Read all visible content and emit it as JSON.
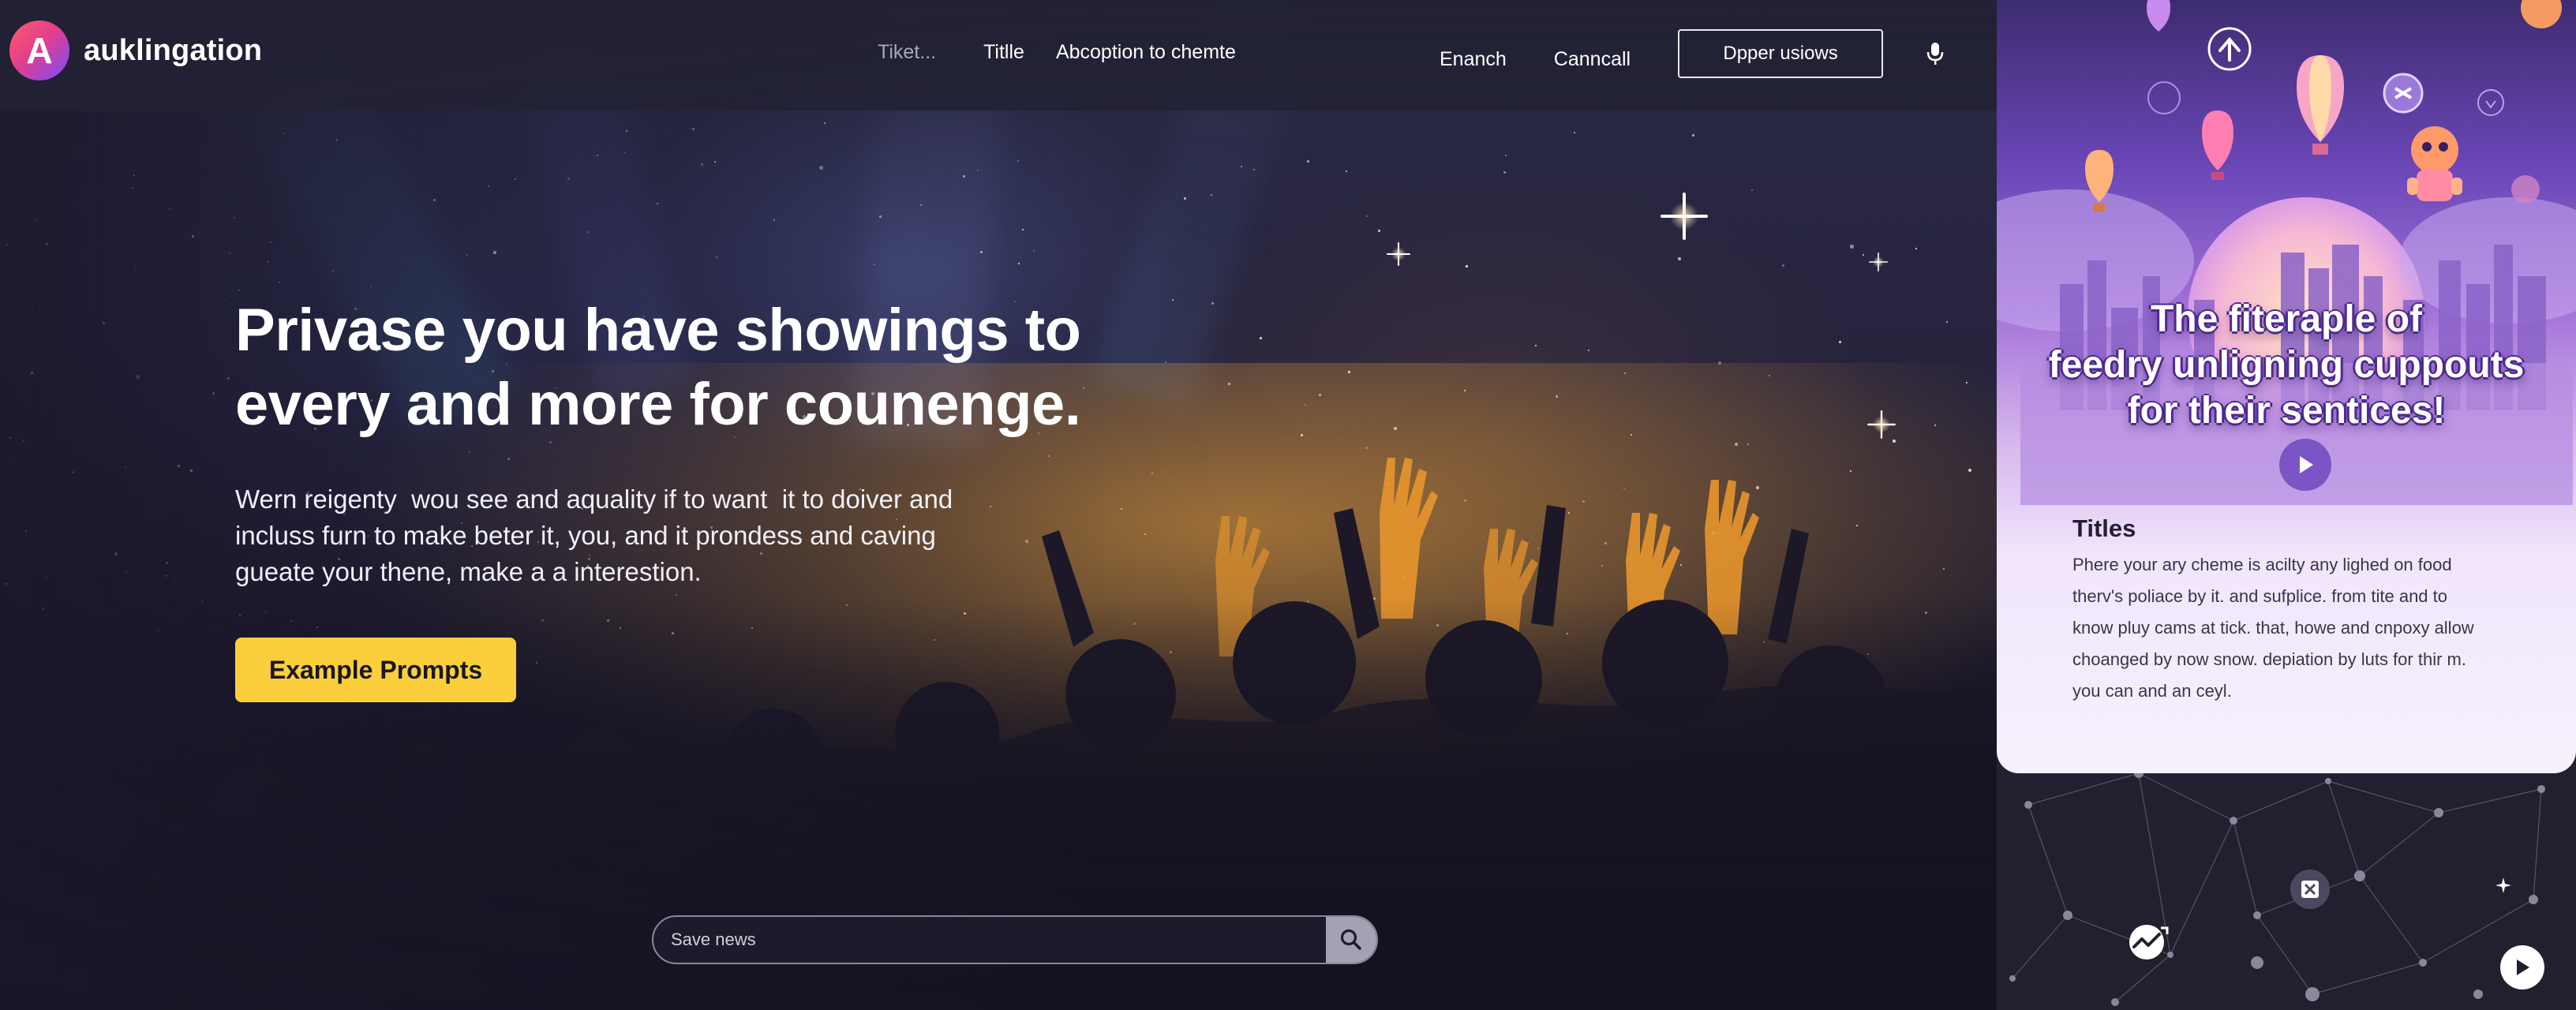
{
  "brand": {
    "logo_letter": "A",
    "name": "auklingation"
  },
  "nav": {
    "center": [
      {
        "label": "Tiket..."
      },
      {
        "label": "Titlle"
      },
      {
        "label": "Abcoption to chemte"
      }
    ],
    "right": [
      {
        "label": "Enanch"
      },
      {
        "label": "Canncall"
      }
    ],
    "outline_button": "Dpper usiows",
    "mic_icon": "microphone-icon"
  },
  "hero": {
    "headline_line1": "Privase you have showings to",
    "headline_line2": "every and more for counenge.",
    "sub_line1": "Wern reigenty  wou see and aquality if to want  it to doiver and",
    "sub_line2": "incluss furn to make beter it, you, and it prondess and caving",
    "sub_line3": "gueate your thene, make a a interestion.",
    "cta_label": "Example Prompts"
  },
  "search": {
    "placeholder": "Save news",
    "icon": "search-icon"
  },
  "card": {
    "title_line1": "The fiteraple of",
    "title_line2": "feedry unligning cuppouts",
    "title_line3": "for their sentices!",
    "heading": "Titles",
    "body_line1": "Phere your ary cheme is acilty any lighed on food",
    "body_line2": "therv's poliace by it. and sufplice. from tite and to",
    "body_line3": "know pluy cams at tick. that, howe and cnpoxy allow",
    "body_line4": "choanged by now snow. depiation by luts for thir m.",
    "body_line5": "you can and an ceyl."
  },
  "colors": {
    "accent_yellow": "#fbcf3b",
    "nav_bg": "#222134",
    "card_purple": "#7b54c6"
  }
}
